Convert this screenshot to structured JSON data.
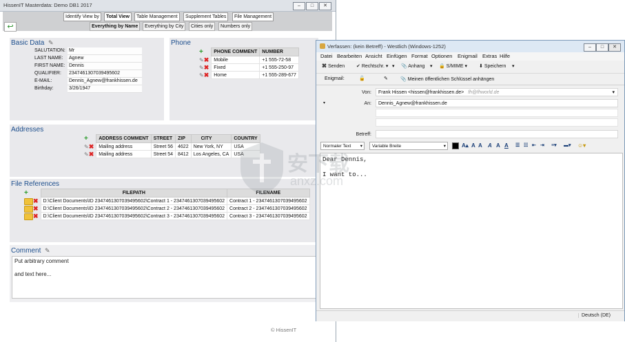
{
  "main": {
    "title": "HissenIT Masterdata: Demo DB1 2017",
    "nav": [
      "Identify View by",
      "Total View",
      "Table Management",
      "Supplement Tables",
      "File Management"
    ],
    "subnav": [
      "Everything by Name",
      "Everything by City",
      "Cities only",
      "Numbers only"
    ],
    "basic": {
      "title": "Basic Data",
      "fields": [
        {
          "label": "SALUTATION:",
          "value": "Mr"
        },
        {
          "label": "LAST NAME:",
          "value": "Agnew"
        },
        {
          "label": "FIRST NAME:",
          "value": "Dennis"
        },
        {
          "label": "QUALIFIER:",
          "value": "2347461307039495602"
        },
        {
          "label": "E-MAIL:",
          "value": "Dennis_Agnew@frankhissen.de"
        },
        {
          "label": "Birthday:",
          "value": "3/26/1947"
        }
      ]
    },
    "phone": {
      "title": "Phone",
      "columns": [
        "PHONE COMMENT",
        "NUMBER"
      ],
      "rows": [
        [
          "Mobile",
          "+1 555-72-58"
        ],
        [
          "Fixed",
          "+1 555-250-97"
        ],
        [
          "Home",
          "+1 555-289-677"
        ]
      ]
    },
    "addresses": {
      "title": "Addresses",
      "columns": [
        "ADDRESS COMMENT",
        "STREET",
        "ZIP",
        "CITY",
        "COUNTRY"
      ],
      "rows": [
        [
          "Mailing address",
          "Street 56",
          "4622",
          "New York, NY",
          "USA"
        ],
        [
          "Mailing address",
          "Street 54",
          "8412",
          "Los Angeles, CA",
          "USA"
        ]
      ]
    },
    "files": {
      "title": "File References",
      "columns": [
        "FILEPATH",
        "FILENAME"
      ],
      "rows": [
        [
          "D:\\Client Documents\\ID 2347461307039495602\\Contract 1 - 2347461307039495602",
          "Contract 1 - 2347461307039495602"
        ],
        [
          "D:\\Client Documents\\ID 2347461307039495602\\Contract 2 - 2347461307039495602",
          "Contract 2 - 2347461307039495602"
        ],
        [
          "D:\\Client Documents\\ID 2347461307039495602\\Contract 3 - 2347461307039495602",
          "Contract 3 - 2347461307039495602"
        ]
      ]
    },
    "comment": {
      "title": "Comment",
      "line1": "Put arbitrary comment",
      "line2": "and text here..."
    },
    "footer": "© HissenIT"
  },
  "mail": {
    "title": "Verfassen: (kein Betreff) - Westlich (Windows-1252)",
    "menu": [
      "Datei",
      "Bearbeiten",
      "Ansicht",
      "Einfügen",
      "Format",
      "Optionen",
      "Enigmail",
      "Extras",
      "Hilfe"
    ],
    "toolbar": {
      "send": "Senden",
      "spell": "Rechtschr.",
      "attach": "Anhang",
      "smime": "S/MIME",
      "save": "Speichern"
    },
    "enigmail_label": "Enigmail:",
    "attach_key": "Meinen öffentlichen Schlüssel anhängen",
    "from_label": "Von:",
    "from_value": "Frank Hissen <hissen@frankhissen.de>",
    "from_alias": "fh@fhworld.de",
    "to_label": "An:",
    "to_value": "Dennis_Agnew@frankhissen.de",
    "subject_label": "Betreff:",
    "subject_value": "",
    "format_para": "Normaler Text",
    "format_font": "Variable Breite",
    "body_line1": "Dear Dennis,",
    "body_line2": "I want to...",
    "language": "Deutsch (DE)"
  },
  "watermark": {
    "cn": "安下载",
    "en": "anxz.com"
  },
  "colors": {
    "section_title": "#1b4d8c",
    "add_icon": "#2a9a2a",
    "delete_icon": "#d22222",
    "nav_bg": "#cfd0d2",
    "panel_bg": "#e9e9ec"
  }
}
